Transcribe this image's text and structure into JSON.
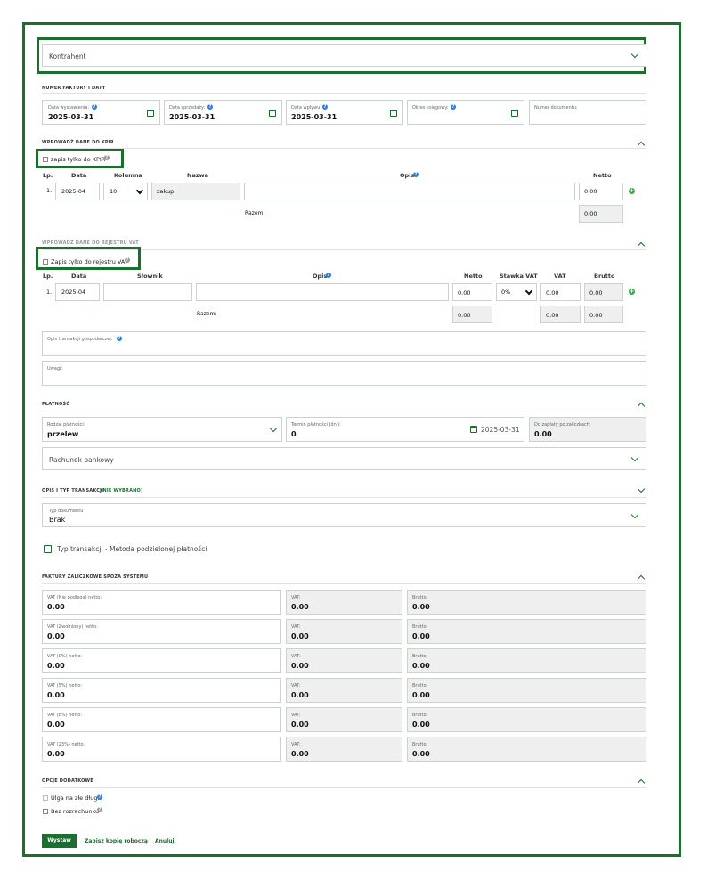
{
  "kontrahent": {
    "label": "Kontrahent"
  },
  "invoice": {
    "section_title": "NUMER FAKTURY I DATY",
    "fields": [
      {
        "label": "Data wystawienia:",
        "value": "2025-03-31"
      },
      {
        "label": "Data sprzedaży:",
        "value": "2025-03-31"
      },
      {
        "label": "Data wpływu:",
        "value": "2025-03-31"
      },
      {
        "label": "Okres księgowy:",
        "value": ""
      },
      {
        "label": "Numer dokumentu:",
        "value": ""
      }
    ]
  },
  "kpir": {
    "section_title": "WPROWADŹ DANE DO KPIR",
    "only_label": "zapis tylko do KPIR",
    "columns": {
      "lp": "Lp.",
      "data": "Data",
      "kolumna": "Kolumna",
      "nazwa": "Nazwa",
      "opis": "Opis",
      "netto": "Netto"
    },
    "row": {
      "lp": "1.",
      "data": "2025-04",
      "kolumna": "10",
      "nazwa": "zakup",
      "opis": "",
      "netto": "0.00"
    },
    "razem_label": "Razem:",
    "razem_netto": "0.00"
  },
  "vat": {
    "section_title": "WPROWADŹ DANE DO REJESTRU VAT",
    "only_label": "Zapis tylko do rejestru VAT",
    "columns": {
      "lp": "Lp.",
      "data": "Data",
      "slownik": "Słownik",
      "opis": "Opis",
      "netto": "Netto",
      "stawka": "Stawka VAT",
      "vat": "VAT",
      "brutto": "Brutto"
    },
    "row": {
      "lp": "1.",
      "data": "2025-04",
      "slownik": "",
      "opis": "",
      "netto": "0.00",
      "stawka": "0%",
      "vat": "0.00",
      "brutto": "0.00"
    },
    "razem_label": "Razem:",
    "razem": {
      "netto": "0.00",
      "vat": "0.00",
      "brutto": "0.00"
    }
  },
  "opis_transakcji": {
    "label": "Opis transakcji gospodarczej:"
  },
  "uwagi": {
    "label": "Uwagi:"
  },
  "platnosc": {
    "section_title": "PŁATNOŚĆ",
    "rodzaj_label": "Rodzaj płatności:",
    "rodzaj_value": "przelew",
    "termin_label": "Termin płatności (dni):",
    "termin_value": "0",
    "termin_date": "2025-03-31",
    "zaplaty_label": "Do zapłaty po zaliczkach:",
    "zaplaty_value": "0.00",
    "rachunek_label": "Rachunek bankowy"
  },
  "opis_typ": {
    "section_title": "OPIS I TYP TRANSAKCJI",
    "status": "(NIE WYBRANO)",
    "typ_label": "Typ dokumentu",
    "typ_value": "Brak",
    "metoda_label": "Typ transakcji - Metoda podzielonej płatności"
  },
  "zaliczkowe": {
    "section_title": "FAKTURY ZALICZKOWE SPOZA SYSTEMU",
    "rows": [
      {
        "label": "VAT (Nie podlega) netto:",
        "value": "0.00",
        "vat_label": "VAT:",
        "vat": "0.00",
        "brutto_label": "Brutto:",
        "brutto": "0.00"
      },
      {
        "label": "VAT (Zwolniony) netto:",
        "value": "0.00",
        "vat_label": "VAT:",
        "vat": "0.00",
        "brutto_label": "Brutto:",
        "brutto": "0.00"
      },
      {
        "label": "VAT (0%) netto:",
        "value": "0.00",
        "vat_label": "VAT:",
        "vat": "0.00",
        "brutto_label": "Brutto:",
        "brutto": "0.00"
      },
      {
        "label": "VAT (5%) netto:",
        "value": "0.00",
        "vat_label": "VAT:",
        "vat": "0.00",
        "brutto_label": "Brutto:",
        "brutto": "0.00"
      },
      {
        "label": "VAT (8%) netto:",
        "value": "0.00",
        "vat_label": "VAT:",
        "vat": "0.00",
        "brutto_label": "Brutto:",
        "brutto": "0.00"
      },
      {
        "label": "VAT (23%) netto:",
        "value": "0.00",
        "vat_label": "VAT:",
        "vat": "0.00",
        "brutto_label": "Brutto:",
        "brutto": "0.00"
      }
    ]
  },
  "opcje": {
    "section_title": "OPCJE DODATKOWE",
    "ulga": "Ulga na złe długi",
    "bez": "Bez rozrachunku"
  },
  "actions": {
    "wystaw": "Wystaw",
    "zapisz": "Zapisz kopię roboczą",
    "anuluj": "Anuluj"
  },
  "colors": {
    "accent": "#1a6e2e",
    "info": "#2a7de1",
    "add": "#3aa34a"
  }
}
